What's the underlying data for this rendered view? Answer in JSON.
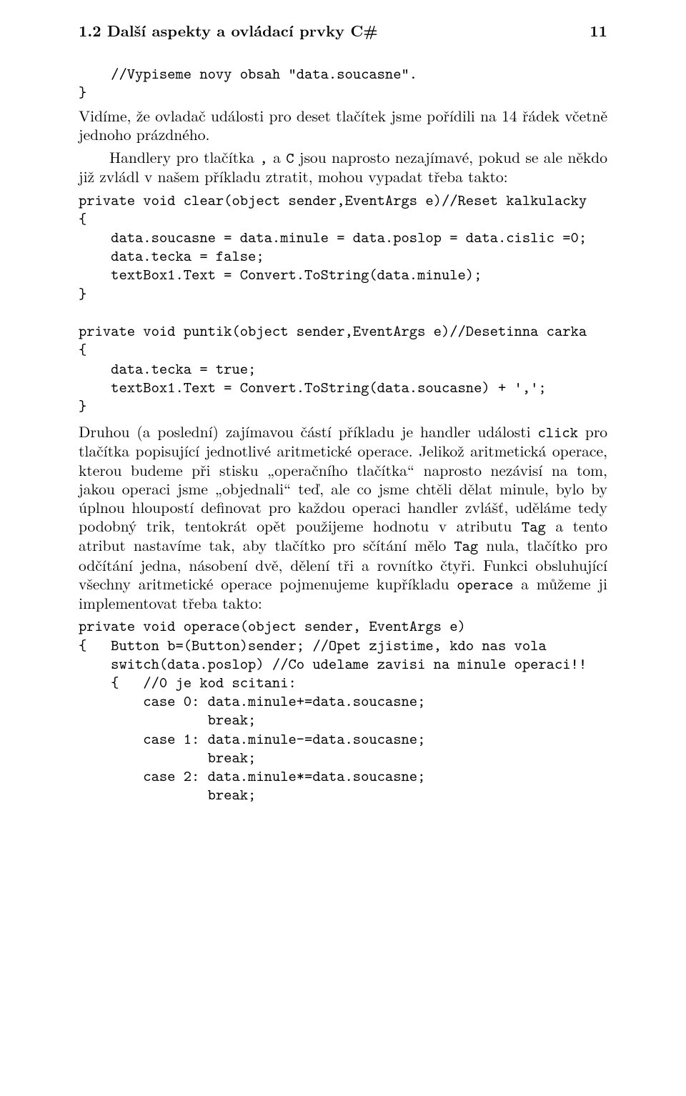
{
  "header": {
    "section": "1.2 Další aspekty a ovládací prvky C#",
    "page": "11"
  },
  "block1": {
    "line1": "    //Vypiseme novy obsah \"data.soucasne\".",
    "line2": "}"
  },
  "para1_pre": "Vidíme, že ovladač události pro deset tlačítek jsme pořídili na 14 řádek včetně jednoho prázdného.",
  "para1_post_a": "Handlery pro tlačítka ",
  "tt_comma": ",",
  "para1_post_b": " a ",
  "tt_C": "C",
  "para1_post_c": " jsou naprosto nezajímavé, pokud se ale někdo již zvládl v našem příkladu ztratit, mohou vypadat třeba takto:",
  "block2": "private void clear(object sender,EventArgs e)//Reset kalkulacky\n{\n    data.soucasne = data.minule = data.poslop = data.cislic =0;\n    data.tecka = false;\n    textBox1.Text = Convert.ToString(data.minule);\n}\n\nprivate void puntik(object sender,EventArgs e)//Desetinna carka\n{\n    data.tecka = true;\n    textBox1.Text = Convert.ToString(data.soucasne) + ',';\n}",
  "para2_a": "Druhou (a poslední) zajímavou částí příkladu je handler události ",
  "tt_click": "click",
  "para2_b": " pro tlačítka popisující jednotlivé aritmetické operace. Jelikož aritmetická operace, kterou budeme při stisku „operačního tlačítka“ naprosto nezávisí na tom, jakou operaci jsme „objednali“ teď, ale co jsme chtěli dělat minule, bylo by úplnou hloupostí definovat pro každou operaci handler zvlášť, uděláme tedy podobný trik, tentokrát opět použijeme hodnotu v atributu ",
  "tt_Tag1": "Tag",
  "para2_c": " a tento atribut nastavíme tak, aby tlačítko pro sčítání mělo ",
  "tt_Tag2": "Tag",
  "para2_d": " nula, tlačítko pro odčítání jedna, násobení dvě, dělení tři a rovnítko čtyři. Funkci obsluhující všechny aritmetické operace pojmenujeme kupříkladu ",
  "tt_operace": "operace",
  "para2_e": " a můžeme ji implementovat třeba takto:",
  "block3": "private void operace(object sender, EventArgs e)\n{   Button b=(Button)sender; //Opet zjistime, kdo nas vola\n    switch(data.poslop) //Co udelame zavisi na minule operaci!!\n    {   //0 je kod scitani:\n        case 0: data.minule+=data.soucasne;\n                break;\n        case 1: data.minule-=data.soucasne;\n                break;\n        case 2: data.minule*=data.soucasne;\n                break;"
}
